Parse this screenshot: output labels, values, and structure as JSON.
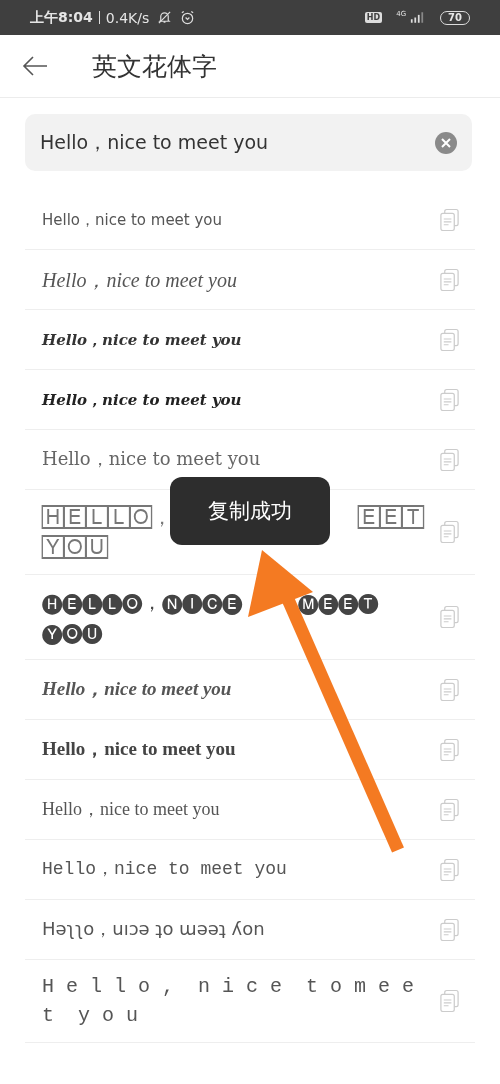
{
  "status_bar": {
    "time": "上午8:04",
    "speed": "0.4K/s",
    "hd": "HD",
    "network": "4G",
    "battery": "70"
  },
  "header": {
    "title": "英文花体字"
  },
  "search": {
    "value": "Hello，nice to meet you"
  },
  "results": [
    {
      "kind": "plain",
      "text": "Hello，nice to meet you"
    },
    {
      "kind": "serif-italic",
      "text": "Hello，nice to meet you"
    },
    {
      "kind": "script",
      "text": "Hello，nice to meet you"
    },
    {
      "kind": "script-bold",
      "text": "Hello，nice to meet you"
    },
    {
      "kind": "serif-light",
      "text": "Hello，nice to meet you"
    },
    {
      "kind": "boxed",
      "lines": [
        [
          "🄷🄴🄻🄻🄾，",
          "🄴🄴🅃"
        ],
        [
          "🅈🄾🅄"
        ]
      ]
    },
    {
      "kind": "circled",
      "lines": [
        [
          "🅗🅔🅛🅛🅞，🅝🅘🅒🅔",
          "🅜🅔🅔🅣"
        ],
        [
          "🅨🅞🅤"
        ]
      ]
    },
    {
      "kind": "bold-italic",
      "text": "Hello，nice to meet you"
    },
    {
      "kind": "blackletter-bold",
      "text": "Hello，nice to meet you"
    },
    {
      "kind": "blackletter",
      "text": "Hello，nice to meet you"
    },
    {
      "kind": "mono",
      "text": "Hello，nice to meet you"
    },
    {
      "kind": "flipped",
      "text": "Həʅʅo，uıɔə ʇo ɯəəʇ ʎon"
    },
    {
      "kind": "spaced",
      "text": "H e l l o ,  n i c e  t o m e e t  y o u"
    }
  ],
  "toast": {
    "text": "复制成功"
  }
}
